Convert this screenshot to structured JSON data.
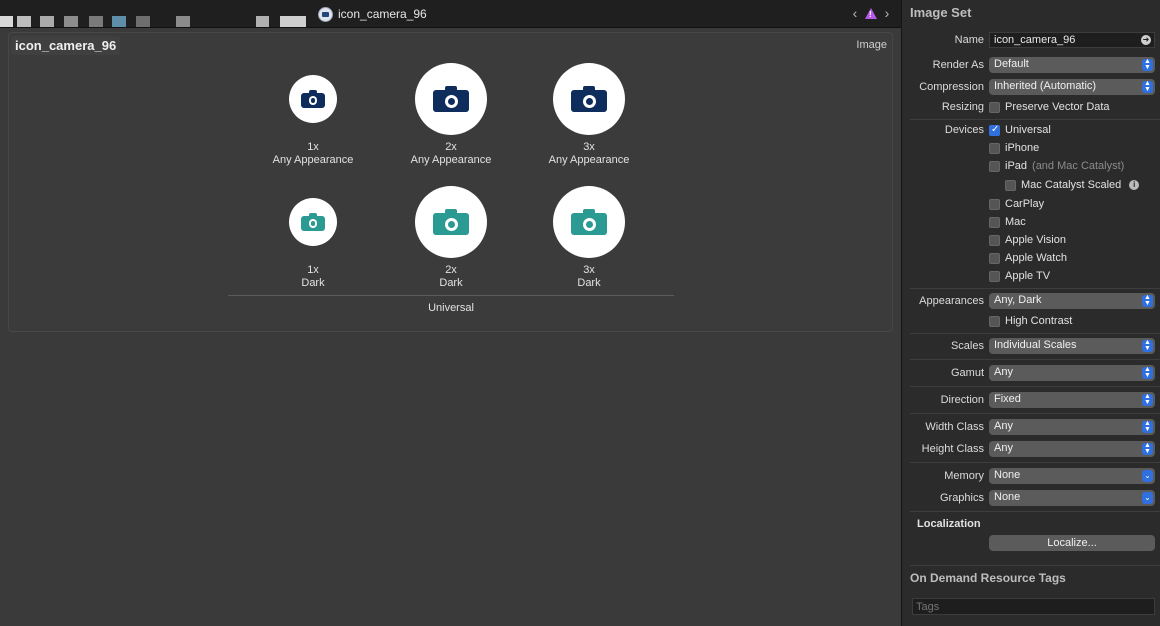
{
  "tabbar": {
    "current_tab": "icon_camera_96",
    "pixel_blocks": [
      "#d8d8d8",
      "#bdbdbd",
      "#aaaaaa",
      "#8c8c8c",
      "#7a7a7a",
      "#5f8ea8",
      "#6e6e6e",
      "#8b8b8b",
      "#b0b0b0",
      "#cfcfcf"
    ]
  },
  "editor": {
    "set_name": "icon_camera_96",
    "set_kind": "Image",
    "colors": {
      "any": "#0f2d5c",
      "dark": "#2a9a92"
    },
    "slots": [
      {
        "scale": "1x",
        "appearance": "Any Appearance"
      },
      {
        "scale": "2x",
        "appearance": "Any Appearance"
      },
      {
        "scale": "3x",
        "appearance": "Any Appearance"
      },
      {
        "scale": "1x",
        "appearance": "Dark"
      },
      {
        "scale": "2x",
        "appearance": "Dark"
      },
      {
        "scale": "3x",
        "appearance": "Dark"
      }
    ],
    "group_label": "Universal"
  },
  "inspector": {
    "title": "Image Set",
    "name": {
      "label": "Name",
      "value": "icon_camera_96"
    },
    "render_as": {
      "label": "Render As",
      "value": "Default"
    },
    "compression": {
      "label": "Compression",
      "value": "Inherited (Automatic)"
    },
    "resizing": {
      "label": "Resizing",
      "option": "Preserve Vector Data"
    },
    "devices": {
      "label": "Devices",
      "universal": "Universal",
      "iphone": "iPhone",
      "ipad": "iPad",
      "ipad_note": "(and Mac Catalyst)",
      "mac_catalyst_scaled": "Mac Catalyst Scaled",
      "carplay": "CarPlay",
      "mac": "Mac",
      "apple_vision": "Apple Vision",
      "apple_watch": "Apple Watch",
      "apple_tv": "Apple TV"
    },
    "appearances": {
      "label": "Appearances",
      "value": "Any, Dark",
      "high_contrast": "High Contrast"
    },
    "scales": {
      "label": "Scales",
      "value": "Individual Scales"
    },
    "gamut": {
      "label": "Gamut",
      "value": "Any"
    },
    "direction": {
      "label": "Direction",
      "value": "Fixed"
    },
    "width_class": {
      "label": "Width Class",
      "value": "Any"
    },
    "height_class": {
      "label": "Height Class",
      "value": "Any"
    },
    "memory": {
      "label": "Memory",
      "value": "None"
    },
    "graphics": {
      "label": "Graphics",
      "value": "None"
    },
    "localization": {
      "label": "Localization",
      "button": "Localize..."
    },
    "odr": {
      "title": "On Demand Resource Tags",
      "placeholder": "Tags"
    }
  }
}
